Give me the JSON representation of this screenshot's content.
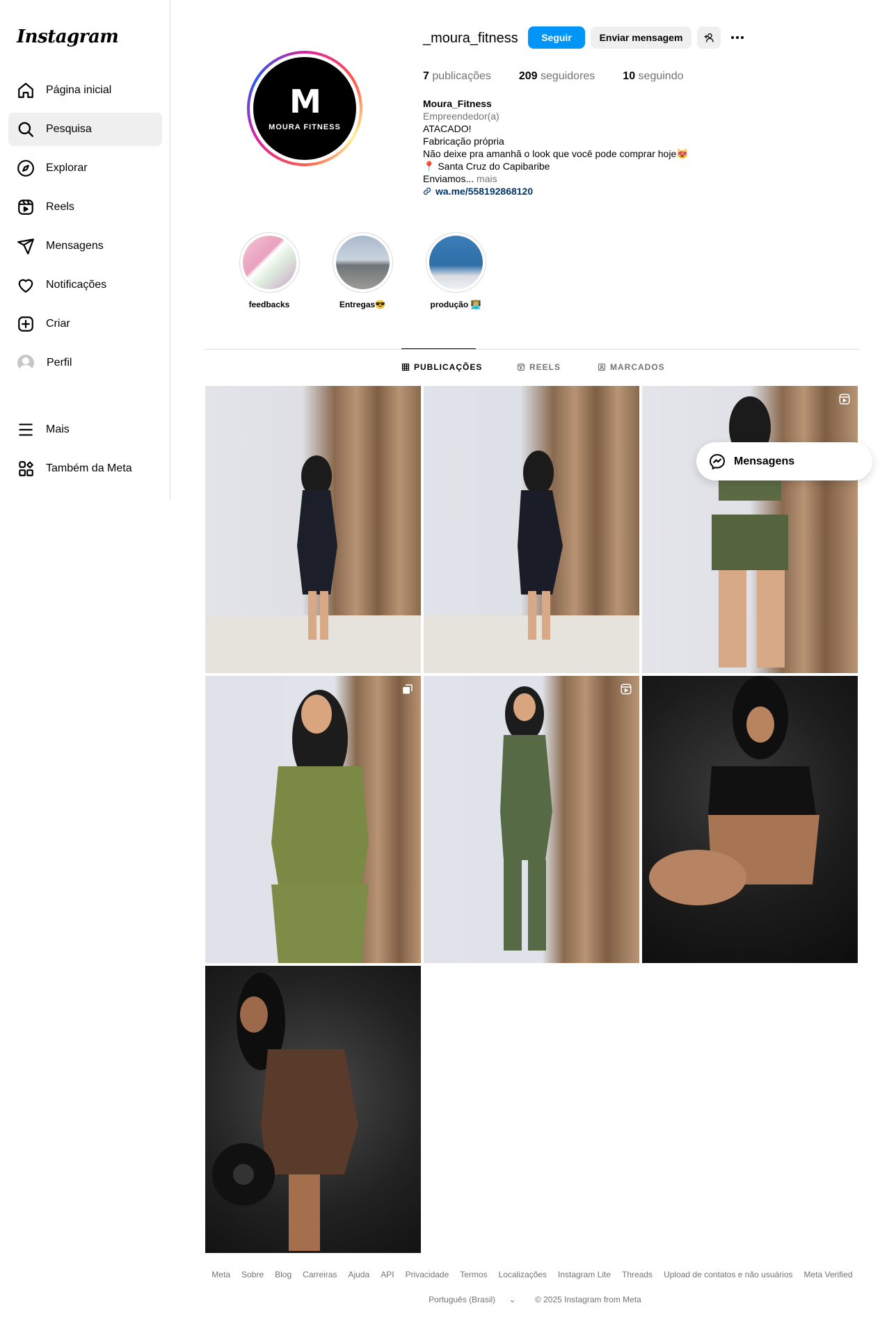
{
  "app": {
    "logo": "Instagram"
  },
  "sidebar": {
    "items": [
      {
        "label": "Página inicial",
        "icon": "home-icon"
      },
      {
        "label": "Pesquisa",
        "icon": "search-icon",
        "active": true
      },
      {
        "label": "Explorar",
        "icon": "compass-icon"
      },
      {
        "label": "Reels",
        "icon": "reels-icon"
      },
      {
        "label": "Mensagens",
        "icon": "messages-icon"
      },
      {
        "label": "Notificações",
        "icon": "heart-icon"
      },
      {
        "label": "Criar",
        "icon": "create-icon"
      },
      {
        "label": "Perfil",
        "icon": "avatar"
      }
    ],
    "bottom": [
      {
        "label": "Mais",
        "icon": "menu-icon"
      },
      {
        "label": "Também da Meta",
        "icon": "meta-icon"
      }
    ]
  },
  "profile": {
    "username": "_moura_fitness",
    "avatar_mark": "M",
    "avatar_brand": "MOURA FITNESS",
    "follow_label": "Seguir",
    "message_label": "Enviar mensagem",
    "stats": {
      "posts_count": "7",
      "posts_label": "publicações",
      "followers_count": "209",
      "followers_label": "seguidores",
      "following_count": "10",
      "following_label": "seguindo"
    },
    "bio": {
      "name": "Moura_Fitness",
      "category": "Empreendedor(a)",
      "line1": "ATACADO!",
      "line2": "Fabricação própria",
      "line3": "Não deixe pra amanhã o look que você pode comprar hoje😻",
      "line4": "📍 Santa Cruz do Capibaribe",
      "line5": "Enviamos...",
      "more": "mais",
      "link": "wa.me/558192868120"
    }
  },
  "highlights": [
    {
      "label": "feedbacks"
    },
    {
      "label": "Entregas😎"
    },
    {
      "label": "produção 👩🏼‍💻"
    }
  ],
  "tabs": [
    {
      "label": "PUBLICAÇÕES",
      "active": true
    },
    {
      "label": "REELS"
    },
    {
      "label": "MARCADOS"
    }
  ],
  "floating": {
    "messages_label": "Mensagens"
  },
  "footer": {
    "links": [
      "Meta",
      "Sobre",
      "Blog",
      "Carreiras",
      "Ajuda",
      "API",
      "Privacidade",
      "Termos",
      "Localizações",
      "Instagram Lite",
      "Threads",
      "Upload de contatos e não usuários",
      "Meta Verified"
    ],
    "language": "Português (Brasil)",
    "copyright": "© 2025 Instagram from Meta"
  }
}
